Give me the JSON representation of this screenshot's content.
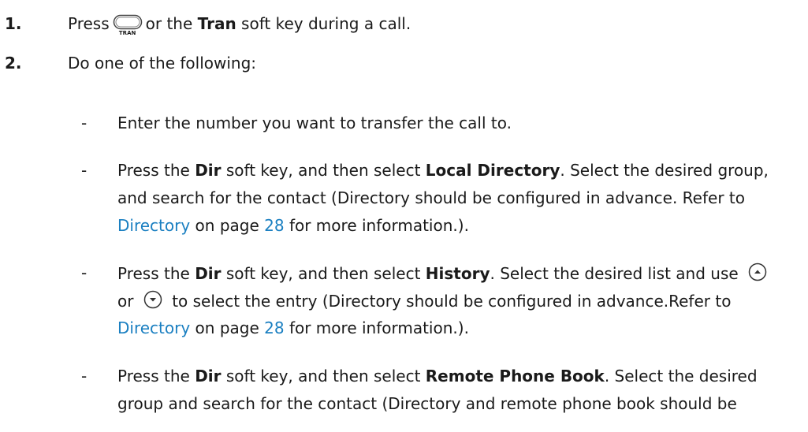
{
  "step1": {
    "number": "1.",
    "press": "Press",
    "key_caption": "TRAN",
    "or_the": "or the",
    "soft_key_name": "Tran",
    "rest": "soft key during a call."
  },
  "step2": {
    "number": "2.",
    "text": "Do one of the following:"
  },
  "bullet_char": "-",
  "options": {
    "enter": "Enter the number you want to transfer the call to.",
    "local": {
      "l1_press_the": "Press the",
      "dir": "Dir",
      "l1_mid": "soft key, and then select",
      "target": "Local Directory",
      "l1_tail": ". Select the desired group,",
      "l2": "and search for the contact (Directory should be configured in advance. Refer to",
      "link": "Directory",
      "on_page": "on page",
      "page": "28",
      "tail": "for more information.)."
    },
    "history": {
      "l1_press_the": "Press the",
      "dir": "Dir",
      "l1_mid": "soft key, and then select",
      "target": "History",
      "l1_tail": ". Select the desired list and use",
      "or": "or",
      "l2_tail": "to select the entry (Directory should be configured in advance.Refer to",
      "link": "Directory",
      "on_page": "on page",
      "page": "28",
      "tail": "for more information.)."
    },
    "remote": {
      "l1_press_the": "Press the",
      "dir": "Dir",
      "l1_mid": "soft key, and then select",
      "target": "Remote Phone Book",
      "l1_tail": ". Select the desired",
      "l2": "group and search for the contact (Directory and remote phone book should be"
    }
  },
  "icons": {
    "tran_key": "tran-key-icon",
    "up_key": "up-arrow-key-icon",
    "down_key": "down-arrow-key-icon"
  },
  "colors": {
    "link": "#1a7fc1",
    "text": "#1a1a1a"
  }
}
